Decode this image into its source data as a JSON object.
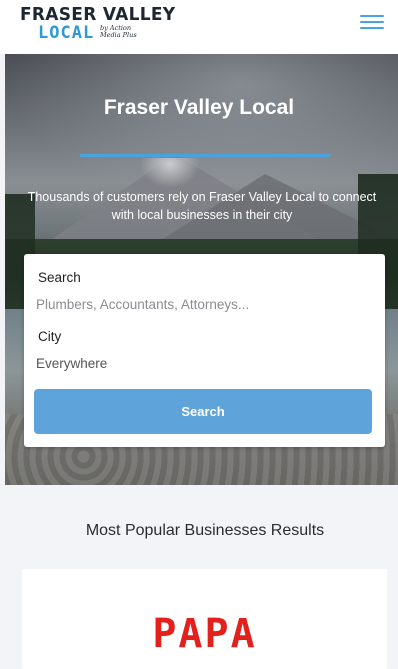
{
  "header": {
    "logo_line1": "FRASER VALLEY",
    "logo_line2": "LOCAL",
    "logo_tagline_1": "by Action",
    "logo_tagline_2": "Media Plus",
    "menu_icon": "hamburger-icon"
  },
  "hero": {
    "title": "Fraser Valley Local",
    "subtitle": "Thousands of customers rely on Fraser Valley Local to connect with local businesses in their city",
    "accent_color": "#4aa3df"
  },
  "search_form": {
    "search_label": "Search",
    "search_placeholder": "Plumbers, Accountants, Attorneys...",
    "city_label": "City",
    "city_value": "Everywhere",
    "button_label": "Search",
    "button_color": "#5fa3db"
  },
  "popular": {
    "title": "Most Popular Businesses Results",
    "first_business_logo_text": "PAPA",
    "logo_color": "#e3201b"
  }
}
